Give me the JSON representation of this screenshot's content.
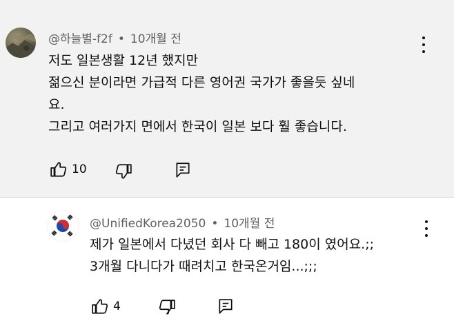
{
  "comments": [
    {
      "author": "@하늘별-f2f",
      "time": "10개월 전",
      "lines": [
        "저도 일본생활 12년 했지만",
        "젊으신 분이라면 가급적 다른 영어권 국가가 좋을듯 싶네",
        "요.",
        "그리고 여러가지 면에서 한국이 일본 보다 훨 좋습니다."
      ],
      "likes": "10"
    },
    {
      "author": "@UnifiedKorea2050",
      "time": "10개월 전",
      "lines": [
        "제가 일본에서 다녔던 회사 다 빼고 180이 였어요.;;",
        "3개월 다니다가 때려치고 한국온거임...;;;"
      ],
      "likes": "4"
    }
  ],
  "separator": "•",
  "icons": {
    "like": "thumbs-up-icon",
    "dislike": "thumbs-down-icon",
    "reply": "reply-icon",
    "more": "more-vert-icon"
  },
  "colors": {
    "highlight_background": "#f2f2f2",
    "meta_text": "#606060",
    "text": "#0f0f0f"
  }
}
